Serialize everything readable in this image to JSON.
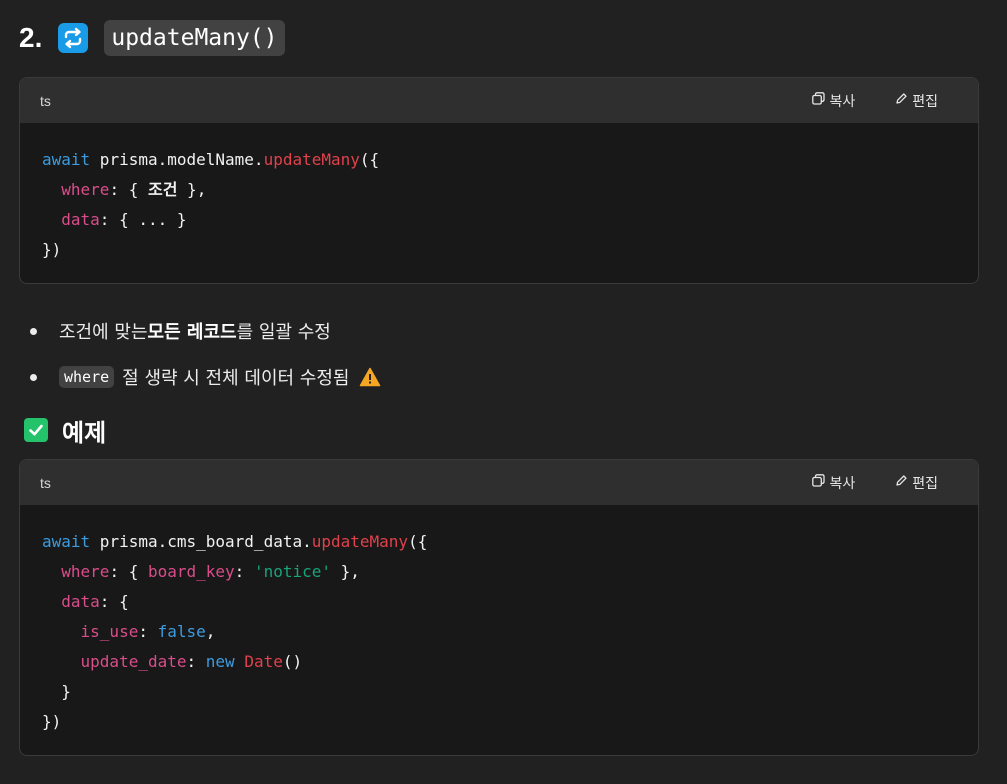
{
  "section": {
    "number": "2.",
    "icon": "repeat-arrows-icon",
    "code_title": "updateMany()"
  },
  "block1": {
    "lang": "ts",
    "copy_label": "복사",
    "edit_label": "편집",
    "code": {
      "l1_await": "await",
      "l1_obj": " prisma.modelName.",
      "l1_fn": "updateMany",
      "l1_end": "({",
      "l2_indent": "  ",
      "l2_prop": "where",
      "l2_a": ": { ",
      "l2_cond": "조건",
      "l2_b": " },",
      "l3_indent": "  ",
      "l3_prop": "data",
      "l3_rest": ": { ... }",
      "l4": "})"
    }
  },
  "bullets": {
    "b1_a": "조건에 맞는 ",
    "b1_bold": "모든 레코드",
    "b1_b": "를 일괄 수정",
    "b2_code": "where",
    "b2_text": "절 생략 시 전체 데이터 수정됨",
    "warning_icon": "warning-icon"
  },
  "example": {
    "icon": "check-mark-icon",
    "title": "예제"
  },
  "block2": {
    "lang": "ts",
    "copy_label": "복사",
    "edit_label": "편집",
    "code": {
      "l1_await": "await",
      "l1_obj": " prisma.cms_board_data.",
      "l1_fn": "updateMany",
      "l1_end": "({",
      "l2_indent": "  ",
      "l2_prop": "where",
      "l2_a": ": { ",
      "l2_key": "board_key",
      "l2_b": ": ",
      "l2_str": "'notice'",
      "l2_c": " },",
      "l3_indent": "  ",
      "l3_prop": "data",
      "l3_rest": ": {",
      "l4_indent": "    ",
      "l4_prop": "is_use",
      "l4_a": ": ",
      "l4_val": "false",
      "l4_b": ",",
      "l5_indent": "    ",
      "l5_prop": "update_date",
      "l5_a": ": ",
      "l5_new": "new",
      "l5_sp": " ",
      "l5_cls": "Date",
      "l5_b": "()",
      "l6": "  }",
      "l7": "})"
    }
  },
  "colors": {
    "background": "#212121",
    "code_bg": "#181818",
    "header_bg": "#2f2f2f",
    "keyword": "#3d9be0",
    "function": "#e0414b",
    "property": "#d94d8a",
    "string": "#1aa37a"
  }
}
